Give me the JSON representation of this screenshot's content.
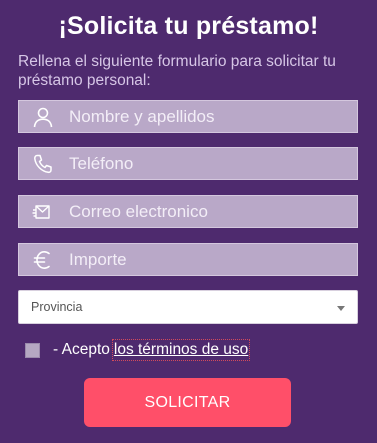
{
  "form": {
    "title": "¡Solicita tu préstamo!",
    "subtitle": "Rellena el siguiente formulario para solicitar tu préstamo personal:",
    "fields": [
      {
        "name": "nombre",
        "icon": "user-icon",
        "placeholder": "Nombre y apellidos",
        "value": ""
      },
      {
        "name": "telefono",
        "icon": "phone-icon",
        "placeholder": "Teléfono",
        "value": ""
      },
      {
        "name": "correo",
        "icon": "envelope-icon",
        "placeholder": "Correo electronico",
        "value": ""
      },
      {
        "name": "importe",
        "icon": "euro-icon",
        "placeholder": "Importe",
        "value": ""
      }
    ],
    "province": {
      "selected": "Provincia"
    },
    "terms": {
      "prefix": "- Acepto",
      "link": "los términos de uso",
      "checked": false
    },
    "submit_label": "SOLICITAR"
  },
  "colors": {
    "background": "#4e2a6e",
    "field": "#b9a8c8",
    "submit": "#ff4f69"
  }
}
